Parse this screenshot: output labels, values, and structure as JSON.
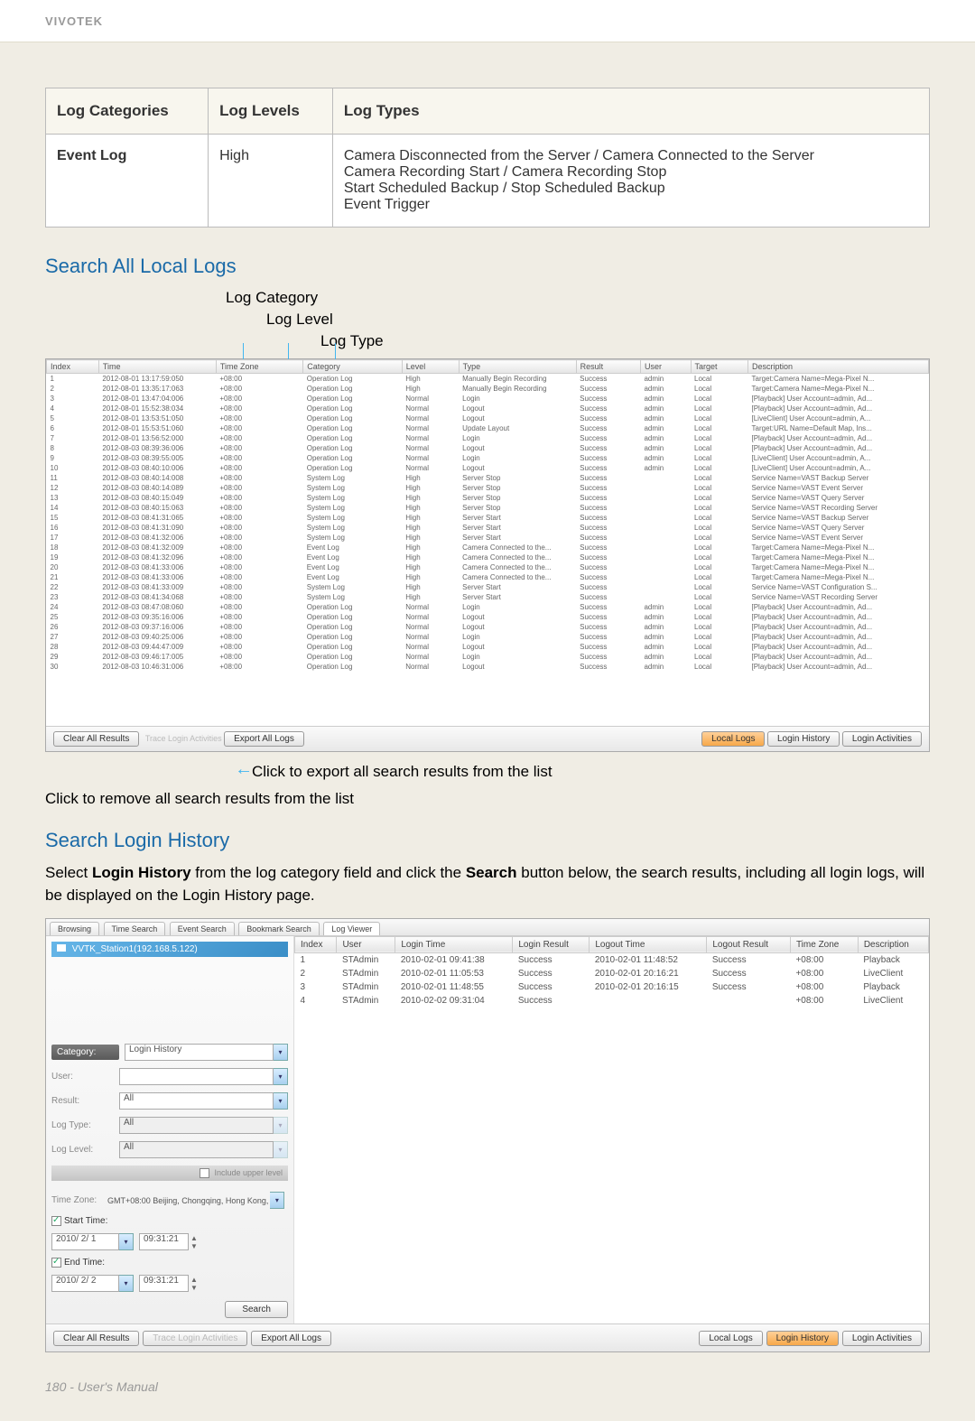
{
  "brand": "VIVOTEK",
  "info_table": {
    "headers": [
      "Log Categories",
      "Log Levels",
      "Log Types"
    ],
    "row": {
      "category": "Event Log",
      "level": "High",
      "types": "Camera Disconnected from the Server / Camera Connected to the Server\nCamera Recording Start / Camera Recording Stop\nStart Scheduled Backup / Stop Scheduled Backup\nEvent Trigger"
    }
  },
  "sections": {
    "search_all": "Search All Local Logs",
    "login_history": "Search Login History"
  },
  "annotations": {
    "log_category": "Log Category",
    "log_level": "Log Level",
    "log_type": "Log Type",
    "export_callout": "Click to export all search results from the list",
    "remove_callout": "Click to remove all search results from the list"
  },
  "log_columns": [
    "Index",
    "Time",
    "Time Zone",
    "Category",
    "Level",
    "Type",
    "Result",
    "User",
    "Target",
    "Description"
  ],
  "log_rows": [
    {
      "idx": "1",
      "time": "2012-08-01 13:17:59:050",
      "tz": "+08:00",
      "cat": "Operation Log",
      "lvl": "High",
      "type": "Manually Begin Recording",
      "res": "Success",
      "user": "admin",
      "tgt": "Local",
      "desc": "Target:Camera Name=Mega-Pixel N..."
    },
    {
      "idx": "2",
      "time": "2012-08-01 13:35:17:063",
      "tz": "+08:00",
      "cat": "Operation Log",
      "lvl": "High",
      "type": "Manually Begin Recording",
      "res": "Success",
      "user": "admin",
      "tgt": "Local",
      "desc": "Target:Camera Name=Mega-Pixel N..."
    },
    {
      "idx": "3",
      "time": "2012-08-01 13:47:04:006",
      "tz": "+08:00",
      "cat": "Operation Log",
      "lvl": "Normal",
      "type": "Login",
      "res": "Success",
      "user": "admin",
      "tgt": "Local",
      "desc": "[Playback] User Account=admin, Ad..."
    },
    {
      "idx": "4",
      "time": "2012-08-01 15:52:38:034",
      "tz": "+08:00",
      "cat": "Operation Log",
      "lvl": "Normal",
      "type": "Logout",
      "res": "Success",
      "user": "admin",
      "tgt": "Local",
      "desc": "[Playback] User Account=admin, Ad..."
    },
    {
      "idx": "5",
      "time": "2012-08-01 13:53:51:050",
      "tz": "+08:00",
      "cat": "Operation Log",
      "lvl": "Normal",
      "type": "Logout",
      "res": "Success",
      "user": "admin",
      "tgt": "Local",
      "desc": "[LiveClient] User Account=admin, A..."
    },
    {
      "idx": "6",
      "time": "2012-08-01 15:53:51:060",
      "tz": "+08:00",
      "cat": "Operation Log",
      "lvl": "Normal",
      "type": "Update Layout",
      "res": "Success",
      "user": "admin",
      "tgt": "Local",
      "desc": "Target:URL Name=Default Map, Ins..."
    },
    {
      "idx": "7",
      "time": "2012-08-01 13:56:52:000",
      "tz": "+08:00",
      "cat": "Operation Log",
      "lvl": "Normal",
      "type": "Login",
      "res": "Success",
      "user": "admin",
      "tgt": "Local",
      "desc": "[Playback] User Account=admin, Ad..."
    },
    {
      "idx": "8",
      "time": "2012-08-03 08:39:36:006",
      "tz": "+08:00",
      "cat": "Operation Log",
      "lvl": "Normal",
      "type": "Logout",
      "res": "Success",
      "user": "admin",
      "tgt": "Local",
      "desc": "[Playback] User Account=admin, Ad..."
    },
    {
      "idx": "9",
      "time": "2012-08-03 08:39:55:005",
      "tz": "+08:00",
      "cat": "Operation Log",
      "lvl": "Normal",
      "type": "Login",
      "res": "Success",
      "user": "admin",
      "tgt": "Local",
      "desc": "[LiveClient] User Account=admin, A..."
    },
    {
      "idx": "10",
      "time": "2012-08-03 08:40:10:006",
      "tz": "+08:00",
      "cat": "Operation Log",
      "lvl": "Normal",
      "type": "Logout",
      "res": "Success",
      "user": "admin",
      "tgt": "Local",
      "desc": "[LiveClient] User Account=admin, A..."
    },
    {
      "idx": "11",
      "time": "2012-08-03 08:40:14:008",
      "tz": "+08:00",
      "cat": "System Log",
      "lvl": "High",
      "type": "Server Stop",
      "res": "Success",
      "user": "",
      "tgt": "Local",
      "desc": "Service Name=VAST Backup Server"
    },
    {
      "idx": "12",
      "time": "2012-08-03 08:40:14:089",
      "tz": "+08:00",
      "cat": "System Log",
      "lvl": "High",
      "type": "Server Stop",
      "res": "Success",
      "user": "",
      "tgt": "Local",
      "desc": "Service Name=VAST Event Server"
    },
    {
      "idx": "13",
      "time": "2012-08-03 08:40:15:049",
      "tz": "+08:00",
      "cat": "System Log",
      "lvl": "High",
      "type": "Server Stop",
      "res": "Success",
      "user": "",
      "tgt": "Local",
      "desc": "Service Name=VAST Query Server"
    },
    {
      "idx": "14",
      "time": "2012-08-03 08:40:15:063",
      "tz": "+08:00",
      "cat": "System Log",
      "lvl": "High",
      "type": "Server Stop",
      "res": "Success",
      "user": "",
      "tgt": "Local",
      "desc": "Service Name=VAST Recording Server"
    },
    {
      "idx": "15",
      "time": "2012-08-03 08:41:31:065",
      "tz": "+08:00",
      "cat": "System Log",
      "lvl": "High",
      "type": "Server Start",
      "res": "Success",
      "user": "",
      "tgt": "Local",
      "desc": "Service Name=VAST Backup Server"
    },
    {
      "idx": "16",
      "time": "2012-08-03 08:41:31:090",
      "tz": "+08:00",
      "cat": "System Log",
      "lvl": "High",
      "type": "Server Start",
      "res": "Success",
      "user": "",
      "tgt": "Local",
      "desc": "Service Name=VAST Query Server"
    },
    {
      "idx": "17",
      "time": "2012-08-03 08:41:32:006",
      "tz": "+08:00",
      "cat": "System Log",
      "lvl": "High",
      "type": "Server Start",
      "res": "Success",
      "user": "",
      "tgt": "Local",
      "desc": "Service Name=VAST Event Server"
    },
    {
      "idx": "18",
      "time": "2012-08-03 08:41:32:009",
      "tz": "+08:00",
      "cat": "Event Log",
      "lvl": "High",
      "type": "Camera Connected to the...",
      "res": "Success",
      "user": "",
      "tgt": "Local",
      "desc": "Target:Camera Name=Mega-Pixel N..."
    },
    {
      "idx": "19",
      "time": "2012-08-03 08:41:32:096",
      "tz": "+08:00",
      "cat": "Event Log",
      "lvl": "High",
      "type": "Camera Connected to the...",
      "res": "Success",
      "user": "",
      "tgt": "Local",
      "desc": "Target:Camera Name=Mega-Pixel N..."
    },
    {
      "idx": "20",
      "time": "2012-08-03 08:41:33:006",
      "tz": "+08:00",
      "cat": "Event Log",
      "lvl": "High",
      "type": "Camera Connected to the...",
      "res": "Success",
      "user": "",
      "tgt": "Local",
      "desc": "Target:Camera Name=Mega-Pixel N..."
    },
    {
      "idx": "21",
      "time": "2012-08-03 08:41:33:006",
      "tz": "+08:00",
      "cat": "Event Log",
      "lvl": "High",
      "type": "Camera Connected to the...",
      "res": "Success",
      "user": "",
      "tgt": "Local",
      "desc": "Target:Camera Name=Mega-Pixel N..."
    },
    {
      "idx": "22",
      "time": "2012-08-03 08:41:33:009",
      "tz": "+08:00",
      "cat": "System Log",
      "lvl": "High",
      "type": "Server Start",
      "res": "Success",
      "user": "",
      "tgt": "Local",
      "desc": "Service Name=VAST Configuration S..."
    },
    {
      "idx": "23",
      "time": "2012-08-03 08:41:34:068",
      "tz": "+08:00",
      "cat": "System Log",
      "lvl": "High",
      "type": "Server Start",
      "res": "Success",
      "user": "",
      "tgt": "Local",
      "desc": "Service Name=VAST Recording Server"
    },
    {
      "idx": "24",
      "time": "2012-08-03 08:47:08:060",
      "tz": "+08:00",
      "cat": "Operation Log",
      "lvl": "Normal",
      "type": "Login",
      "res": "Success",
      "user": "admin",
      "tgt": "Local",
      "desc": "[Playback] User Account=admin, Ad..."
    },
    {
      "idx": "25",
      "time": "2012-08-03 09:35:16:006",
      "tz": "+08:00",
      "cat": "Operation Log",
      "lvl": "Normal",
      "type": "Logout",
      "res": "Success",
      "user": "admin",
      "tgt": "Local",
      "desc": "[Playback] User Account=admin, Ad..."
    },
    {
      "idx": "26",
      "time": "2012-08-03 09:37:16:006",
      "tz": "+08:00",
      "cat": "Operation Log",
      "lvl": "Normal",
      "type": "Logout",
      "res": "Success",
      "user": "admin",
      "tgt": "Local",
      "desc": "[Playback] User Account=admin, Ad..."
    },
    {
      "idx": "27",
      "time": "2012-08-03 09:40:25:006",
      "tz": "+08:00",
      "cat": "Operation Log",
      "lvl": "Normal",
      "type": "Login",
      "res": "Success",
      "user": "admin",
      "tgt": "Local",
      "desc": "[Playback] User Account=admin, Ad..."
    },
    {
      "idx": "28",
      "time": "2012-08-03 09:44:47:009",
      "tz": "+08:00",
      "cat": "Operation Log",
      "lvl": "Normal",
      "type": "Logout",
      "res": "Success",
      "user": "admin",
      "tgt": "Local",
      "desc": "[Playback] User Account=admin, Ad..."
    },
    {
      "idx": "29",
      "time": "2012-08-03 09:46:17:005",
      "tz": "+08:00",
      "cat": "Operation Log",
      "lvl": "Normal",
      "type": "Login",
      "res": "Success",
      "user": "admin",
      "tgt": "Local",
      "desc": "[Playback] User Account=admin, Ad..."
    },
    {
      "idx": "30",
      "time": "2012-08-03 10:46:31:006",
      "tz": "+08:00",
      "cat": "Operation Log",
      "lvl": "Normal",
      "type": "Logout",
      "res": "Success",
      "user": "admin",
      "tgt": "Local",
      "desc": "[Playback] User Account=admin, Ad..."
    }
  ],
  "bottom_buttons": {
    "clear": "Clear All Results",
    "trace_text": "Trace Login Activities",
    "export": "Export All Logs",
    "local_logs": "Local Logs",
    "login_history": "Login History",
    "login_activities": "Login Activities"
  },
  "login_intro": "Select Login History from the log category field and click the Search button below, the search results, including all login logs, will be displayed on the Login History page.",
  "login_tabs": [
    "Browsing",
    "Time Search",
    "Event Search",
    "Bookmark Search",
    "Log Viewer"
  ],
  "station_name": "VVTK_Station1(192.168.5.122)",
  "login_form": {
    "category_label": "Category:",
    "category_value": "Login History",
    "user_label": "User:",
    "user_value": "",
    "result_label": "Result:",
    "result_value": "All",
    "logtype_label": "Log Type:",
    "logtype_value": "All",
    "loglevel_label": "Log Level:",
    "loglevel_value": "All",
    "include_text": "Include upper level",
    "tz_label": "Time Zone:",
    "tz_value": "GMT+08:00 Beijing, Chongqing, Hong Kong,",
    "start_label": "Start Time:",
    "start_date": "2010/ 2/ 1",
    "start_time": "09:31:21",
    "end_label": "End Time:",
    "end_date": "2010/ 2/ 2",
    "end_time": "09:31:21",
    "search_btn": "Search"
  },
  "login_columns": [
    "Index",
    "User",
    "Login Time",
    "Login Result",
    "Logout Time",
    "Logout Result",
    "Time Zone",
    "Description"
  ],
  "login_rows": [
    {
      "idx": "1",
      "user": "STAdmin",
      "lt": "2010-02-01 09:41:38",
      "lr": "Success",
      "ot": "2010-02-01 11:48:52",
      "or": "Success",
      "tz": "+08:00",
      "desc": "Playback"
    },
    {
      "idx": "2",
      "user": "STAdmin",
      "lt": "2010-02-01 11:05:53",
      "lr": "Success",
      "ot": "2010-02-01 20:16:21",
      "or": "Success",
      "tz": "+08:00",
      "desc": "LiveClient"
    },
    {
      "idx": "3",
      "user": "STAdmin",
      "lt": "2010-02-01 11:48:55",
      "lr": "Success",
      "ot": "2010-02-01 20:16:15",
      "or": "Success",
      "tz": "+08:00",
      "desc": "Playback"
    },
    {
      "idx": "4",
      "user": "STAdmin",
      "lt": "2010-02-02 09:31:04",
      "lr": "Success",
      "ot": "",
      "or": "",
      "tz": "+08:00",
      "desc": "LiveClient"
    }
  ],
  "login_bottom": {
    "clear": "Clear All Results",
    "trace": "Trace Login Activities",
    "export": "Export All Logs",
    "local_logs": "Local Logs",
    "login_history": "Login History",
    "login_activities": "Login Activities"
  },
  "footer": "180 - User's Manual"
}
